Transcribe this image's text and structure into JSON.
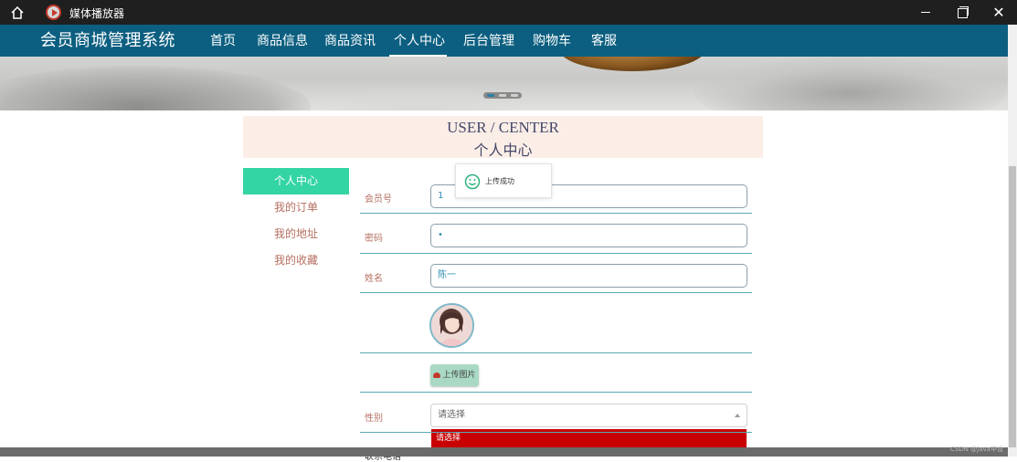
{
  "window": {
    "title": "媒体播放器",
    "icons": [
      "home-icon",
      "media-player-icon",
      "minimize-icon",
      "maximize-icon",
      "close-icon"
    ]
  },
  "nav": {
    "brand": "会员商城管理系统",
    "items": [
      {
        "label": "首页"
      },
      {
        "label": "商品信息"
      },
      {
        "label": "商品资讯"
      },
      {
        "label": "个人中心",
        "active": true
      },
      {
        "label": "后台管理"
      },
      {
        "label": "购物车"
      },
      {
        "label": "客服"
      }
    ]
  },
  "banner": {
    "slides": 3,
    "active_slide": 1
  },
  "user_center": {
    "title_en": "USER / CENTER",
    "title_cn": "个人中心"
  },
  "side_menu": [
    {
      "label": "个人中心",
      "active": true
    },
    {
      "label": "我的订单"
    },
    {
      "label": "我的地址"
    },
    {
      "label": "我的收藏"
    }
  ],
  "form": {
    "member_no": {
      "label": "会员号",
      "value": "1"
    },
    "password": {
      "label": "密码",
      "value": "•"
    },
    "name": {
      "label": "姓名",
      "value": "陈一"
    },
    "upload_button": "上传图片",
    "gender": {
      "label": "性别",
      "selected": "请选择",
      "options": [
        "请选择"
      ]
    },
    "phone_label": "联系电话"
  },
  "toast": {
    "text": "上传成功",
    "icon": "smile-icon"
  },
  "watermark": "CSDN @Java毕设",
  "colors": {
    "nav_bg": "#0c5f80",
    "active_menu": "#34d5a4",
    "header_bg": "#fbeee7",
    "accent_text": "#b56f61",
    "dropdown_highlight": "#c80000"
  }
}
